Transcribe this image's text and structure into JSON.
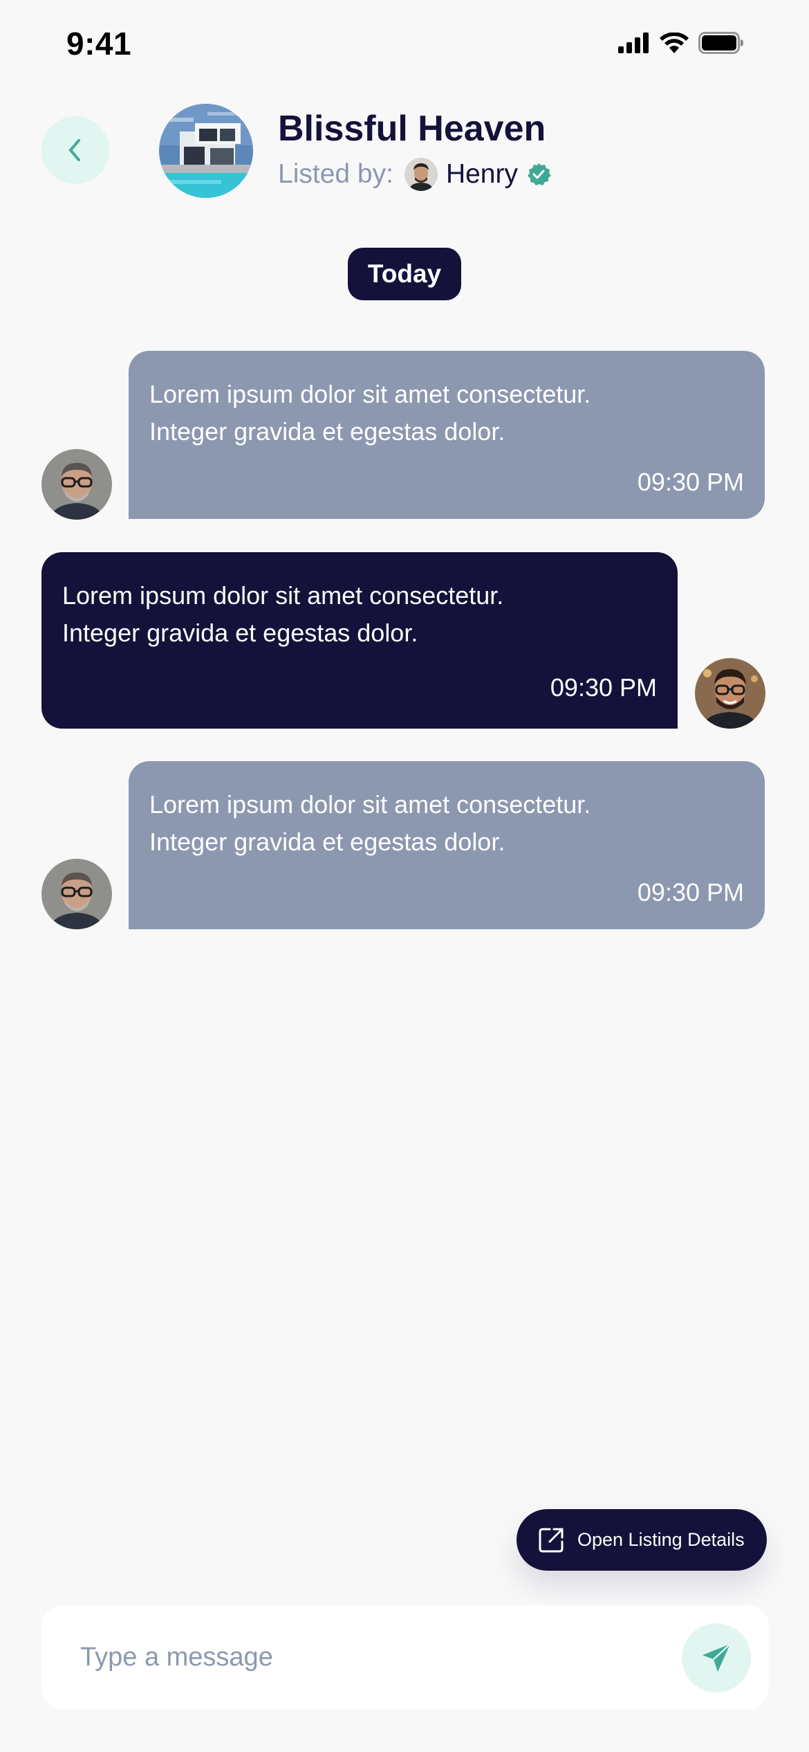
{
  "status_bar": {
    "time": "9:41"
  },
  "header": {
    "title": "Blissful Heaven",
    "listed_by_label": "Listed by:",
    "lister_name": "Henry"
  },
  "date_separator": "Today",
  "messages": [
    {
      "direction": "incoming",
      "text": "Lorem ipsum dolor sit amet consectetur.\nInteger gravida et egestas dolor.",
      "time": "09:30 PM"
    },
    {
      "direction": "outgoing",
      "text": "Lorem ipsum dolor sit amet consectetur.\nInteger gravida et egestas dolor.",
      "time": "09:30 PM"
    },
    {
      "direction": "incoming",
      "text": "Lorem ipsum dolor sit amet consectetur.\nInteger gravida et egestas dolor.",
      "time": "09:30 PM"
    }
  ],
  "open_listing_button": {
    "label": "Open Listing Details",
    "icon": "external-link-icon"
  },
  "composer": {
    "placeholder": "Type a message",
    "value": "",
    "send_icon": "send-icon"
  },
  "colors": {
    "primary": "#14123a",
    "incoming_bubble": "#8c98b0",
    "accent": "#3fa997",
    "accent_bg": "#e1f5f1",
    "background": "#f8f8f9"
  },
  "icons": {
    "back": "chevron-left-icon",
    "verified": "verified-badge-icon",
    "signal": "signal-icon",
    "wifi": "wifi-icon",
    "battery": "battery-icon"
  }
}
